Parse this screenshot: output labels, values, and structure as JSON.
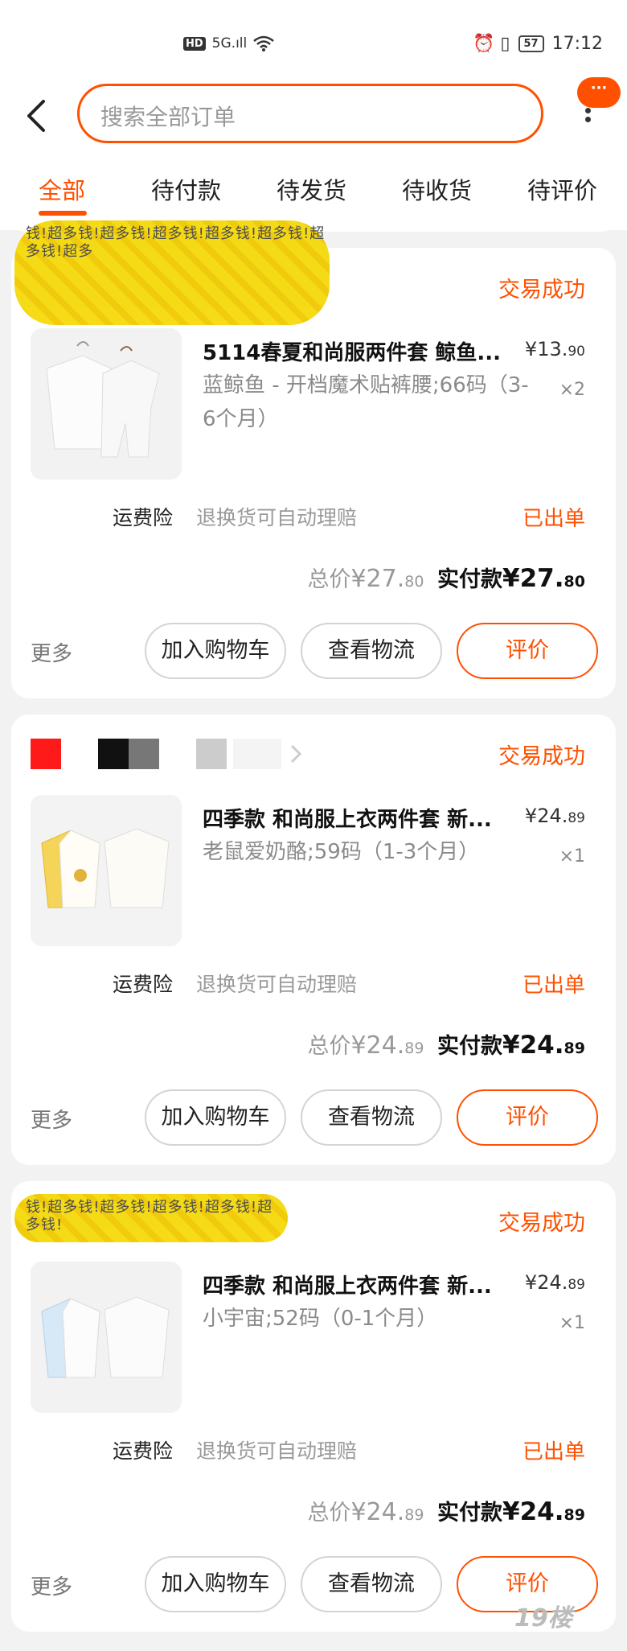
{
  "status_bar": {
    "left_hd": "HD",
    "left_signal": "5G.ıll",
    "right_icons": "⏰ ▯",
    "battery": "57",
    "time": "17:12"
  },
  "header": {
    "search_placeholder": "搜索全部订单",
    "bubble": "···"
  },
  "tabs": [
    {
      "label": "全部"
    },
    {
      "label": "待付款"
    },
    {
      "label": "待发货"
    },
    {
      "label": "待收货"
    },
    {
      "label": "待评价"
    }
  ],
  "orders": [
    {
      "status": "交易成功",
      "title": "5114春夏和尚服两件套  鲸鱼...",
      "price_main": "¥13.",
      "price_dec": "90",
      "sku": "蓝鲸鱼 - 开档魔术贴裤腰;66码（3-6个月）",
      "qty": "×2",
      "svc_label": "运费险",
      "svc_desc": "退换货可自动理赔",
      "shipped": "已出单",
      "total_label": "总价",
      "total_main": "¥27.",
      "total_dec": "80",
      "paid_label": "实付款",
      "paid_main": "¥27.",
      "paid_dec": "80",
      "more": "更多",
      "btn_cart": "加入购物车",
      "btn_logistics": "查看物流",
      "btn_review": "评价",
      "scribble": "钱!超多钱!超多钱!超多钱!超多钱!超多钱!超多钱!超多"
    },
    {
      "status": "交易成功",
      "title": "四季款 和尚服上衣两件套  新...",
      "price_main": "¥24.",
      "price_dec": "89",
      "sku": "老鼠爱奶酪;59码（1-3个月）",
      "qty": "×1",
      "svc_label": "运费险",
      "svc_desc": "退换货可自动理赔",
      "shipped": "已出单",
      "total_label": "总价",
      "total_main": "¥24.",
      "total_dec": "89",
      "paid_label": "实付款",
      "paid_main": "¥24.",
      "paid_dec": "89",
      "more": "更多",
      "btn_cart": "加入购物车",
      "btn_logistics": "查看物流",
      "btn_review": "评价"
    },
    {
      "status": "交易成功",
      "title": "四季款 和尚服上衣两件套  新...",
      "price_main": "¥24.",
      "price_dec": "89",
      "sku": "小宇宙;52码（0-1个月）",
      "qty": "×1",
      "svc_label": "运费险",
      "svc_desc": "退换货可自动理赔",
      "shipped": "已出单",
      "total_label": "总价",
      "total_main": "¥24.",
      "total_dec": "89",
      "paid_label": "实付款",
      "paid_main": "¥24.",
      "paid_dec": "89",
      "more": "更多",
      "btn_cart": "加入购物车",
      "btn_logistics": "查看物流",
      "btn_review": "评价",
      "scribble": "钱!超多钱!超多钱!超多钱!超多钱!超多钱!"
    }
  ],
  "colors": {
    "accent": "#ff5000",
    "scribble_yellow": "#f5d90a",
    "redact_red": "#ff1a1a"
  },
  "watermark": "19楼"
}
